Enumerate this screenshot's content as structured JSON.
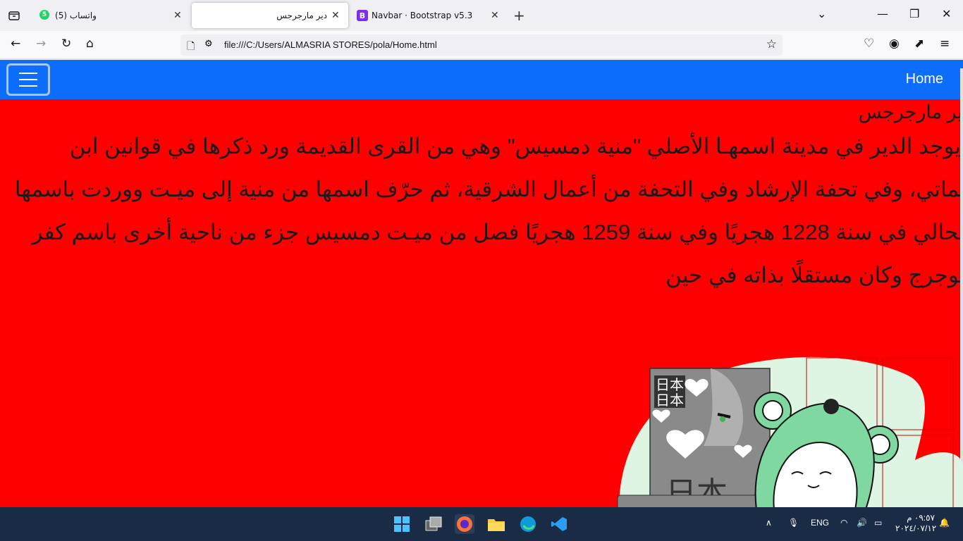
{
  "browser": {
    "tabs": [
      {
        "title": "واتساب (5)",
        "badge": "5",
        "active": false
      },
      {
        "title": "دير مارجرجس",
        "active": true
      },
      {
        "title": "Navbar · Bootstrap v5.3",
        "badge": "B",
        "active": false
      }
    ],
    "url": "file:///C:/Users/ALMASRIA STORES/pola/Home.html"
  },
  "page": {
    "navbar": {
      "home_label": "Home",
      "bg_color": "#0d6efd"
    },
    "bg_color": "#ff0000",
    "heading": "دير مارجرجس",
    "body": "ويوجد الدير في مدينة اسمهـا الأصلي \"منية دمسيس\" وهي من القرى القديمة ورد ذكرها في قوانين ابن مماتي، وفي تحفة الإرشاد وفي التحفة من أعمال الشرقية، ثم حرّف اسمها من منية إلى ميـت ووردت باسمها الحالي في سنة 1228 هجريًا وفي سنة 1259 هجريًا فصل من ميـت دمسيس جزء من ناحية أخرى باسم كفر أبوجرج وكان مستقلًا بذاته في حين",
    "illustration_text": "日本"
  },
  "taskbar": {
    "language": "ENG",
    "time": "٠٩:٥٧ م",
    "date": "٢٠٢٤/٠٧/١٢"
  }
}
